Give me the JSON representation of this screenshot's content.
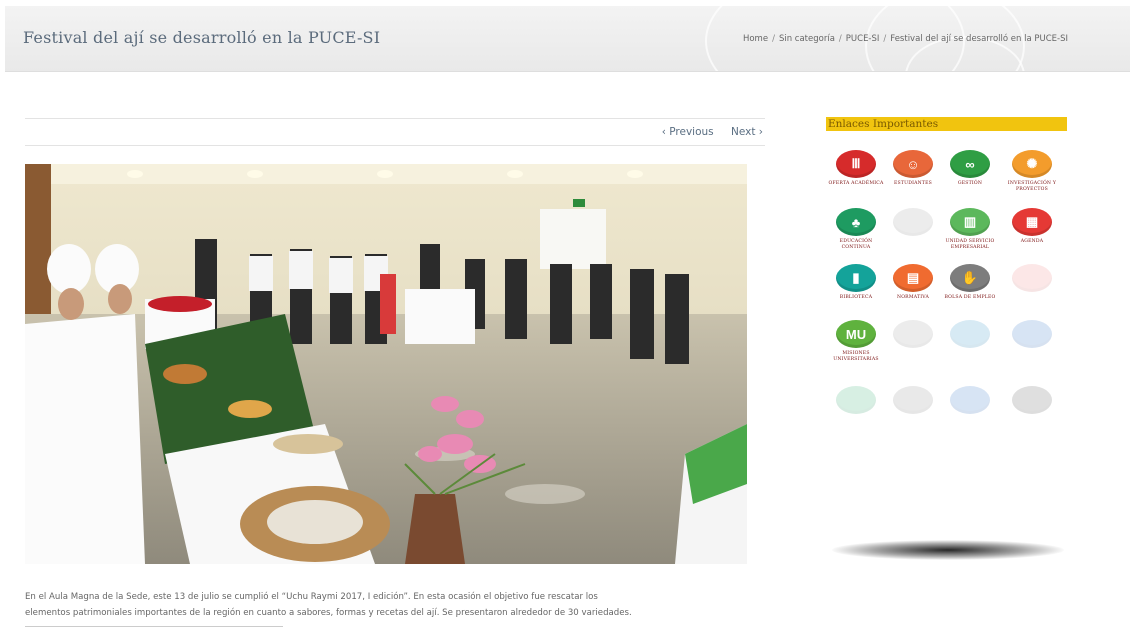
{
  "header": {
    "title": "Festival del ají se desarrolló en la PUCE-SI",
    "breadcrumb": [
      "Home",
      "Sin categoría",
      "PUCE-SI",
      "Festival del ají se desarrolló en la PUCE-SI"
    ]
  },
  "post_nav": {
    "previous": "‹ Previous",
    "next": "Next ›"
  },
  "caption": {
    "line1": "En el Aula Magna de la Sede, este 13 de julio se cumplió el “Uchu Raymi 2017, I edición”. En esta ocasión el objetivo fue rescatar los",
    "line2": "elementos patrimoniales importantes de la región en cuanto a sabores, formas y recetas del ají. Se presentaron alrededor de 30 variedades."
  },
  "sidebar": {
    "title": "Enlaces Importantes",
    "links": [
      {
        "label": "Oferta Académica",
        "icon": "columns-icon",
        "color": "#d62b2b",
        "glyph": "Ⅲ"
      },
      {
        "label": "Estudiantes",
        "icon": "people-icon",
        "color": "#e8673a",
        "glyph": "☺"
      },
      {
        "label": "Gestión",
        "icon": "infinity-icon",
        "color": "#2f9e44",
        "glyph": "∞"
      },
      {
        "label": "Investigación y Proyectos",
        "icon": "atom-icon",
        "color": "#f39c2c",
        "glyph": "✺"
      },
      {
        "label": "Educación Continua",
        "icon": "group-icon",
        "color": "#1e9b61",
        "glyph": "♣"
      },
      {
        "label": "",
        "icon": "faded-icon",
        "color": "#999999",
        "glyph": ""
      },
      {
        "label": "Unidad Servicio Empresarial",
        "icon": "bar-chart-icon",
        "color": "#5cb85c",
        "glyph": "▥"
      },
      {
        "label": "Agenda",
        "icon": "calendar-icon",
        "color": "#e53935",
        "glyph": "▦"
      },
      {
        "label": "Biblioteca",
        "icon": "books-icon",
        "color": "#14a39a",
        "glyph": "▮"
      },
      {
        "label": "Normativa",
        "icon": "document-icon",
        "color": "#f06b30",
        "glyph": "▤"
      },
      {
        "label": "Bolsa de Empleo",
        "icon": "handshake-icon",
        "color": "#7d7d7d",
        "glyph": "✋"
      },
      {
        "label": "",
        "icon": "faded-icon",
        "color": "#f08080",
        "glyph": ""
      },
      {
        "label": "Misiones Universitarias",
        "icon": "mu-logo-icon",
        "color": "#5fb23e",
        "glyph": "MU"
      },
      {
        "label": "",
        "icon": "faded-icon",
        "color": "#999999",
        "glyph": ""
      },
      {
        "label": "",
        "icon": "faded-icon",
        "color": "#2a8fc8",
        "glyph": ""
      },
      {
        "label": "",
        "icon": "faded-icon",
        "color": "#2a6fc8",
        "glyph": ""
      },
      {
        "label": "",
        "icon": "faded-icon",
        "color": "#2aa86a",
        "glyph": ""
      },
      {
        "label": "",
        "icon": "faded-icon",
        "color": "#888888",
        "glyph": ""
      },
      {
        "label": "",
        "icon": "faded-icon",
        "color": "#2a6fc8",
        "glyph": ""
      },
      {
        "label": "",
        "icon": "faded-icon",
        "color": "#555555",
        "glyph": ""
      }
    ]
  }
}
